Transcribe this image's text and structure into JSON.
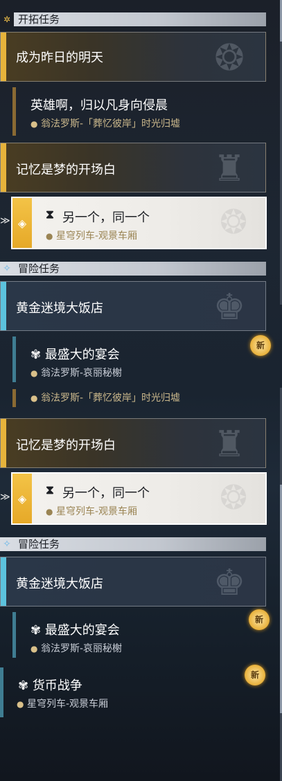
{
  "sections": {
    "trailblaze": {
      "label": "开拓任务"
    },
    "adventure": {
      "label": "冒险任务"
    }
  },
  "quests": {
    "main1": {
      "title": "成为昨日的明天"
    },
    "main1_sub": {
      "title": "英雄啊，归以凡身向侵晨",
      "location": "翁法罗斯-「葬忆彼岸」时光归墟"
    },
    "main2": {
      "title": "记忆是梦的开场白"
    },
    "main2_sub": {
      "title": "另一个，同一个",
      "location": "星穹列车-观景车厢"
    },
    "adv1": {
      "title": "黄金迷境大饭店"
    },
    "adv1_sub": {
      "title": "最盛大的宴会",
      "location": "翁法罗斯-哀丽秘榭"
    },
    "adv2_sub": {
      "title": "货币战争",
      "location": "星穹列车-观景车厢"
    }
  },
  "badges": {
    "new": "新"
  },
  "colors": {
    "gold": "#e6b33b",
    "blue": "#5cc2dd",
    "selected_bg": "#f2f0ec"
  }
}
